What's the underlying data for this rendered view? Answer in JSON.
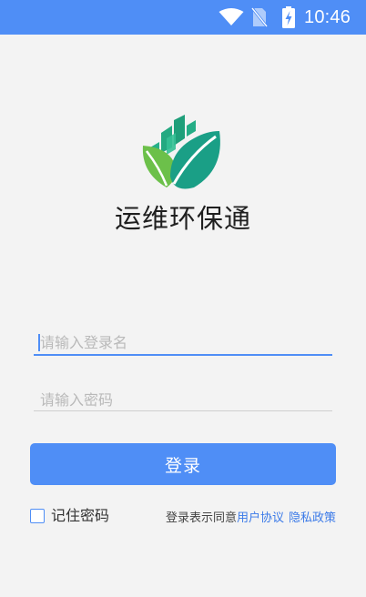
{
  "status_bar": {
    "time": "10:46",
    "icons": [
      "wifi-icon",
      "no-sim-icon",
      "battery-charging-icon"
    ],
    "color": "#4f8ef6"
  },
  "app": {
    "name": "运维环保通",
    "logo": "leaf-building-logo"
  },
  "login_form": {
    "username_placeholder": "请输入登录名",
    "password_placeholder": "请输入密码",
    "login_label": "登录",
    "remember_label": "记住密码",
    "agreement_prefix": "登录表示同意",
    "user_agreement_link": "用户协议",
    "privacy_policy_link": "隐私政策"
  },
  "colors": {
    "accent": "#4f8ef6",
    "link": "#3b7ae8",
    "background": "#f3f3f3"
  }
}
